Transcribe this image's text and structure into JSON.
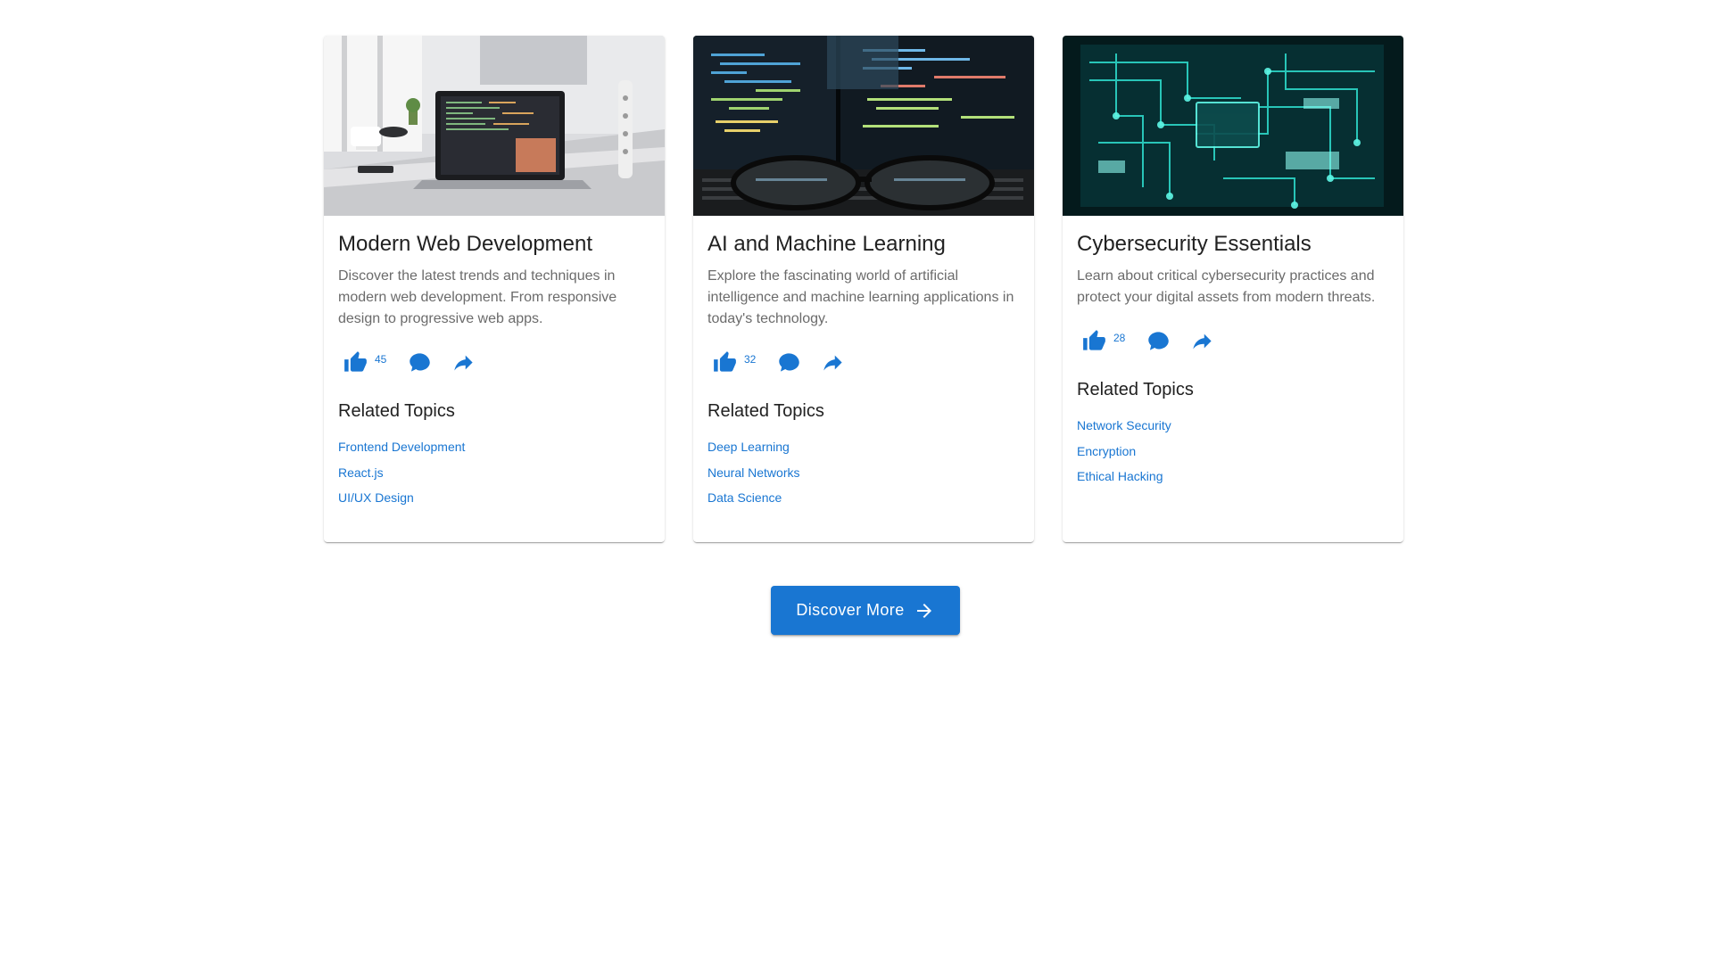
{
  "cards": [
    {
      "title": "Modern Web Development",
      "description": "Discover the latest trends and techniques in modern web development. From responsive design to progressive web apps.",
      "likes": "45",
      "related_title": "Related Topics",
      "topics": [
        "Frontend Development",
        "React.js",
        "UI/UX Design"
      ],
      "image": "laptop-on-desk-photo"
    },
    {
      "title": "AI and Machine Learning",
      "description": "Explore the fascinating world of artificial intelligence and machine learning applications in today's technology.",
      "likes": "32",
      "related_title": "Related Topics",
      "topics": [
        "Deep Learning",
        "Neural Networks",
        "Data Science"
      ],
      "image": "code-monitors-with-glasses-photo"
    },
    {
      "title": "Cybersecurity Essentials",
      "description": "Learn about critical cybersecurity practices and protect your digital assets from modern threats.",
      "likes": "28",
      "related_title": "Related Topics",
      "topics": [
        "Network Security",
        "Encryption",
        "Ethical Hacking"
      ],
      "image": "circuit-board-photo"
    }
  ],
  "icons": {
    "like": "thumb-up-icon",
    "comment": "comment-icon",
    "share": "share-icon",
    "arrow": "arrow-right-icon"
  },
  "discover_button": "Discover More",
  "colors": {
    "primary": "#1976d2",
    "text": "#212121",
    "secondary_text": "#6b6b6b"
  }
}
